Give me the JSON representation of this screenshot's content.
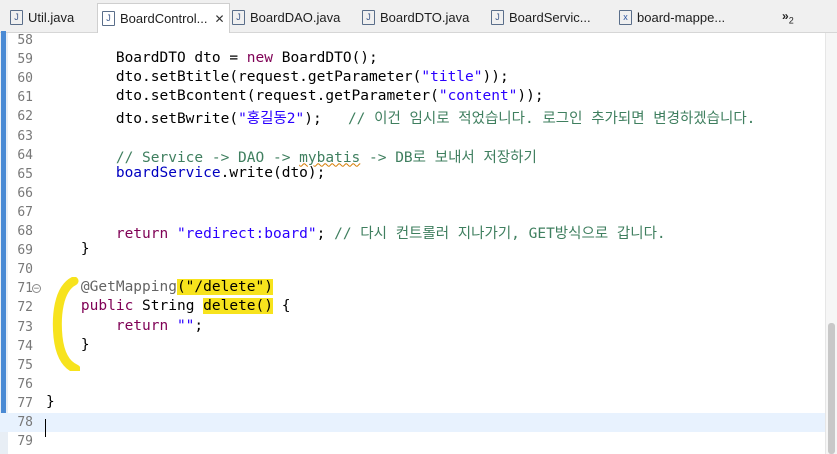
{
  "tabs": [
    {
      "label": "Util.java",
      "icon": "java-file-icon",
      "active": false
    },
    {
      "label": "BoardControl...",
      "icon": "java-file-icon",
      "active": true
    },
    {
      "label": "BoardDAO.java",
      "icon": "java-file-icon",
      "active": false
    },
    {
      "label": "BoardDTO.java",
      "icon": "java-file-icon",
      "active": false
    },
    {
      "label": "BoardServic...",
      "icon": "java-file-icon",
      "active": false
    },
    {
      "label": "board-mappe...",
      "icon": "xml-file-icon",
      "active": false
    }
  ],
  "overflow": {
    "label": "»",
    "count": "2"
  },
  "colors": {
    "keyword": "#7f0055",
    "string": "#2a00ff",
    "comment": "#3f7f5f",
    "annotation": "#646464",
    "highlight": "#f7e31d",
    "current_line": "#e8f2fe"
  },
  "lines": [
    {
      "n": "58",
      "code": []
    },
    {
      "n": "59",
      "code": [
        [
          "p",
          "        BoardDTO dto = "
        ],
        [
          "kw",
          "new"
        ],
        [
          "p",
          " BoardDTO();"
        ]
      ]
    },
    {
      "n": "60",
      "code": [
        [
          "p",
          "        dto.setBtitle(request.getParameter("
        ],
        [
          "str",
          "\"title\""
        ],
        [
          "p",
          "));"
        ]
      ]
    },
    {
      "n": "61",
      "code": [
        [
          "p",
          "        dto.setBcontent(request.getParameter("
        ],
        [
          "str",
          "\"content\""
        ],
        [
          "p",
          "));"
        ]
      ]
    },
    {
      "n": "62",
      "code": [
        [
          "p",
          "        dto.setBwrite("
        ],
        [
          "str",
          "\"홍길동2\""
        ],
        [
          "p",
          ");   "
        ],
        [
          "cmt",
          "// 이건 임시로 적었습니다. 로그인 추가되면 변경하겠습니다."
        ]
      ]
    },
    {
      "n": "63",
      "code": []
    },
    {
      "n": "64",
      "code": [
        [
          "cmt",
          "        // Service -> DAO -> "
        ],
        [
          "cmt squig",
          "mybatis"
        ],
        [
          "cmt",
          " -> DB로 보내서 저장하기"
        ]
      ]
    },
    {
      "n": "65",
      "code": [
        [
          "var",
          "        boardService"
        ],
        [
          "p",
          ".write(dto);"
        ]
      ]
    },
    {
      "n": "66",
      "code": []
    },
    {
      "n": "67",
      "code": []
    },
    {
      "n": "68",
      "code": [
        [
          "kw",
          "        return"
        ],
        [
          "p",
          " "
        ],
        [
          "str",
          "\"redirect:board\""
        ],
        [
          "p",
          "; "
        ],
        [
          "cmt",
          "// 다시 컨트롤러 지나가기, GET방식으로 갑니다."
        ]
      ]
    },
    {
      "n": "69",
      "code": [
        [
          "p",
          "    }"
        ]
      ]
    },
    {
      "n": "70",
      "code": []
    },
    {
      "n": "71",
      "fold": true,
      "code": [
        [
          "ann",
          "    @GetMapping"
        ],
        [
          "hl",
          "(\"/delete\")"
        ]
      ]
    },
    {
      "n": "72",
      "code": [
        [
          "kw",
          "    public"
        ],
        [
          "p",
          " String "
        ],
        [
          "hl",
          "delete()"
        ],
        [
          "p",
          " {"
        ]
      ]
    },
    {
      "n": "73",
      "code": [
        [
          "kw",
          "        return"
        ],
        [
          "p",
          " "
        ],
        [
          "str",
          "\"\""
        ],
        [
          "p",
          ";"
        ]
      ]
    },
    {
      "n": "74",
      "code": [
        [
          "p",
          "    }"
        ]
      ]
    },
    {
      "n": "75",
      "code": []
    },
    {
      "n": "76",
      "code": []
    },
    {
      "n": "77",
      "code": [
        [
          "p",
          "}"
        ]
      ]
    },
    {
      "n": "78",
      "code": [],
      "current": true
    },
    {
      "n": "79",
      "code": []
    }
  ]
}
